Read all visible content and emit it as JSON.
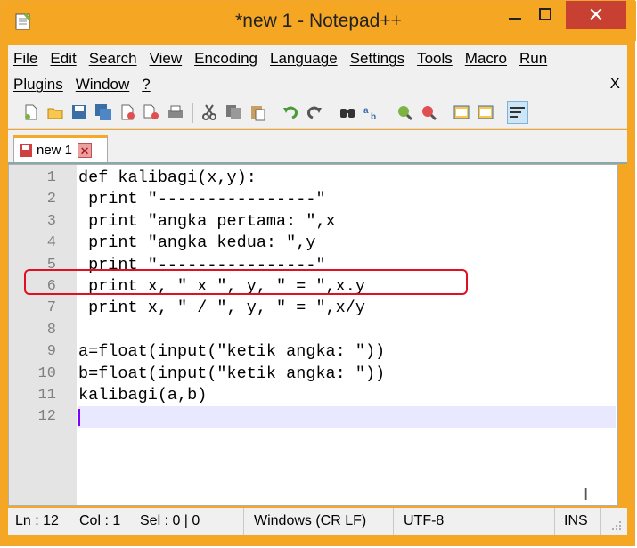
{
  "window": {
    "title": "*new 1 - Notepad++",
    "close_glyph": "✕"
  },
  "menu": {
    "row1": [
      "File",
      "Edit",
      "Search",
      "View",
      "Encoding",
      "Language",
      "Settings",
      "Tools",
      "Macro",
      "Run"
    ],
    "row2": [
      "Plugins",
      "Window",
      "?"
    ],
    "close_doc": "X"
  },
  "toolbar": {
    "icons": [
      "new-file-icon",
      "open-file-icon",
      "save-icon",
      "save-all-icon",
      "close-icon",
      "close-all-icon",
      "print-icon",
      "cut-icon",
      "copy-icon",
      "paste-icon",
      "undo-icon",
      "redo-icon",
      "find-icon",
      "replace-icon",
      "zoom-in-icon",
      "zoom-out-icon",
      "sync-vertical-icon",
      "sync-horizontal-icon",
      "word-wrap-icon"
    ]
  },
  "tab": {
    "label": "new 1",
    "close_glyph": "✕"
  },
  "editor": {
    "lines": [
      {
        "num": "1",
        "text": "def kalibagi(x,y):"
      },
      {
        "num": "2",
        "text": " print \"----------------\""
      },
      {
        "num": "3",
        "text": " print \"angka pertama: \",x"
      },
      {
        "num": "4",
        "text": " print \"angka kedua: \",y"
      },
      {
        "num": "5",
        "text": " print \"----------------\""
      },
      {
        "num": "6",
        "text": " print x, \" x \", y, \" = \",x.y"
      },
      {
        "num": "7",
        "text": " print x, \" / \", y, \" = \",x/y"
      },
      {
        "num": "8",
        "text": ""
      },
      {
        "num": "9",
        "text": "a=float(input(\"ketik angka: \"))"
      },
      {
        "num": "10",
        "text": "b=float(input(\"ketik angka: \"))"
      },
      {
        "num": "11",
        "text": "kalibagi(a,b)"
      },
      {
        "num": "12",
        "text": ""
      }
    ]
  },
  "status": {
    "ln": "Ln : 12",
    "col": "Col : 1",
    "sel": "Sel : 0 | 0",
    "eol": "Windows (CR LF)",
    "encoding": "UTF-8",
    "mode": "INS"
  },
  "colors": {
    "titlebar": "#f5a623",
    "close_button": "#c84031",
    "highlight_box": "#e01020",
    "caret": "#8000ff",
    "current_line": "#e8e8ff"
  }
}
